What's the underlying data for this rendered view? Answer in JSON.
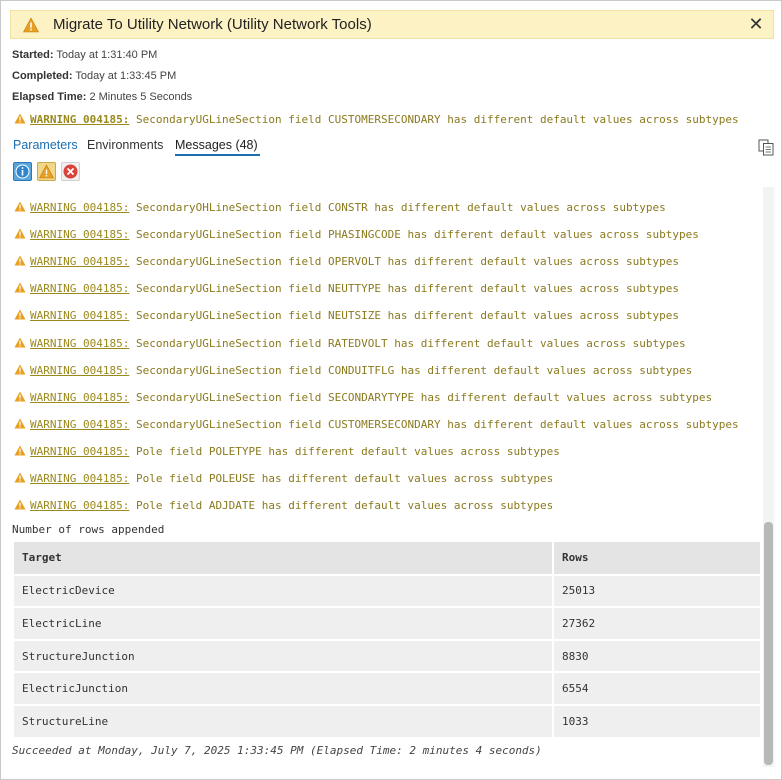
{
  "window": {
    "title": "Migrate To Utility Network (Utility Network Tools)",
    "close_glyph": "✕"
  },
  "summary": {
    "started_label": "Started:",
    "started_value": "Today at 1:31:40 PM",
    "completed_label": "Completed:",
    "completed_value": "Today at 1:33:45 PM",
    "elapsed_label": "Elapsed Time:",
    "elapsed_value": "2 Minutes 5 Seconds",
    "top_warning_code": "WARNING 004185:",
    "top_warning_text": "SecondaryUGLineSection field CUSTOMERSECONDARY has different default values across subtypes"
  },
  "tabs": [
    {
      "label": "Parameters"
    },
    {
      "label": "Environments"
    },
    {
      "label": "Messages (48)",
      "active": true
    }
  ],
  "icons": {
    "info": "info-icon",
    "warning": "warning-icon",
    "error": "error-icon",
    "copy": "copy-icon"
  },
  "colors": {
    "title_bg": "#fcf2c4",
    "warning_text": "#8a7a1e",
    "tab_accent": "#1a6fb3"
  },
  "messages": [
    {
      "code": "WARNING 004185:",
      "text": "SecondaryOHLineSection field CONSTR has different default values across subtypes"
    },
    {
      "code": "WARNING 004185:",
      "text": "SecondaryUGLineSection field PHASINGCODE has different default values across subtypes"
    },
    {
      "code": "WARNING 004185:",
      "text": "SecondaryUGLineSection field OPERVOLT has different default values across subtypes"
    },
    {
      "code": "WARNING 004185:",
      "text": "SecondaryUGLineSection field NEUTTYPE has different default values across subtypes"
    },
    {
      "code": "WARNING 004185:",
      "text": "SecondaryUGLineSection field NEUTSIZE has different default values across subtypes"
    },
    {
      "code": "WARNING 004185:",
      "text": "SecondaryUGLineSection field RATEDVOLT has different default values across subtypes"
    },
    {
      "code": "WARNING 004185:",
      "text": "SecondaryUGLineSection field CONDUITFLG has different default values across subtypes"
    },
    {
      "code": "WARNING 004185:",
      "text": "SecondaryUGLineSection field SECONDARYTYPE has different default values across subtypes"
    },
    {
      "code": "WARNING 004185:",
      "text": "SecondaryUGLineSection field CUSTOMERSECONDARY has different default values across subtypes"
    },
    {
      "code": "WARNING 004185:",
      "text": "Pole field POLETYPE has different default values across subtypes"
    },
    {
      "code": "WARNING 004185:",
      "text": "Pole field POLEUSE has different default values across subtypes"
    },
    {
      "code": "WARNING 004185:",
      "text": "Pole field ADJDATE has different default values across subtypes"
    }
  ],
  "rows_label": "Number of rows appended",
  "results_table": {
    "columns": [
      "Target",
      "Rows"
    ],
    "rows": [
      [
        "ElectricDevice",
        "25013"
      ],
      [
        "ElectricLine",
        "27362"
      ],
      [
        "StructureJunction",
        "8830"
      ],
      [
        "ElectricJunction",
        "6554"
      ],
      [
        "StructureLine",
        "1033"
      ]
    ]
  },
  "footer": "Succeeded at Monday, July 7, 2025 1:33:45 PM (Elapsed Time: 2 minutes 4 seconds)"
}
